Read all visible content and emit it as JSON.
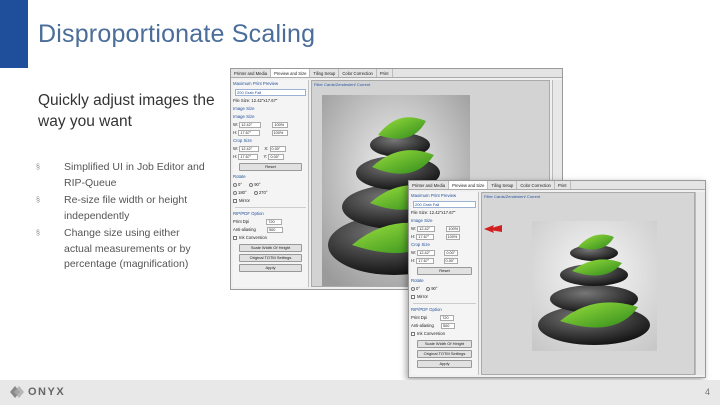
{
  "slide": {
    "title": "Disproportionate Scaling",
    "subtitle": "Quickly adjust images the way you want",
    "bullets": [
      "Simplified UI in Job Editor and RIP-Queue",
      "Re-size file width or height independently",
      "Change size using either actual measurements or by percentage (magnification)"
    ],
    "bullet_marker": "§"
  },
  "footer": {
    "logo_text": "ONYX",
    "page_number": "4"
  },
  "editor": {
    "tabs": [
      "Printer and Media",
      "Preview and Size",
      "Tiling Setup",
      "Color Correction",
      "Print"
    ],
    "active_tab": "Preview and Size",
    "preview_label": "Filter Cards/Zendesiert/ Current",
    "size_preset_label": "Maximum Print Preview",
    "size_preset_value": "200 Grab Fall",
    "file_size": "File Size: 12.42\"x17.67\"",
    "image_size_label": "Image Size",
    "image_size_alt_label": "Image Size",
    "w_label": "W:",
    "h_label": "H:",
    "w_value": "12.42\"",
    "h_value": "17.67\"",
    "w_pct": "100%",
    "h_pct": "100%",
    "crop_size_label": "Crop Size",
    "crop_w": "12.42\"",
    "crop_h": "17.67\"",
    "crop_x_label": "X:",
    "crop_y_label": "Y:",
    "crop_x": "0.00\"",
    "crop_y": "0.00\"",
    "reset_label": "Reset",
    "rotate_label": "Rotate",
    "rot_options": [
      "0°",
      "90°",
      "180°",
      "270°"
    ],
    "mirror_label": "Mirror",
    "mirror_h": "Mirror",
    "rip_label": "RIP/PDF Option",
    "res_label": "Print Dpi",
    "res_value": "720",
    "ink_label": "Anti-aliasing",
    "ink_value": "500",
    "checkbox_label": "Ink Conversion",
    "btn_scale_width": "Scale Width Of Height",
    "btn_original": "Original TOTM Settings",
    "btn_apply": "Apply"
  },
  "colors": {
    "accent": "#1f4e9a",
    "title": "#4a6d99",
    "leaf": "#5cb82e",
    "stone": "#333333",
    "arrow": "#d21f1f"
  },
  "icons": {
    "link": "chain-link-icon",
    "logo": "onyx-logo-icon",
    "arrow": "red-arrow-icon",
    "leaf_logo": "green-leaf-logo-icon"
  },
  "watermark": "ONYX"
}
